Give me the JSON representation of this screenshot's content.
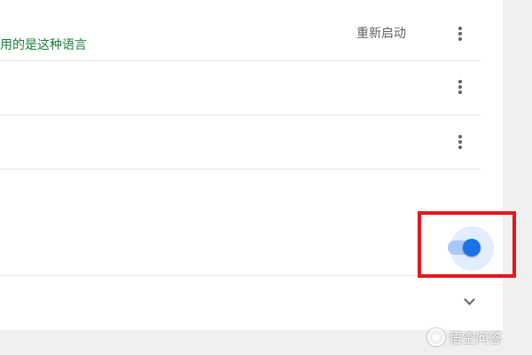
{
  "settings_panel": {
    "language_row": {
      "status_text": "用的是这种语言",
      "restart_label": "重新启动"
    },
    "spellcheck_toggle": {
      "state": "on"
    }
  },
  "watermark": {
    "text": "悟空问答"
  },
  "colors": {
    "status_green": "#188038",
    "accent_blue": "#1a73e8",
    "highlight_red": "#e4181c"
  },
  "icons": {
    "more": "more-vert-icon",
    "expand": "chevron-down-icon"
  }
}
